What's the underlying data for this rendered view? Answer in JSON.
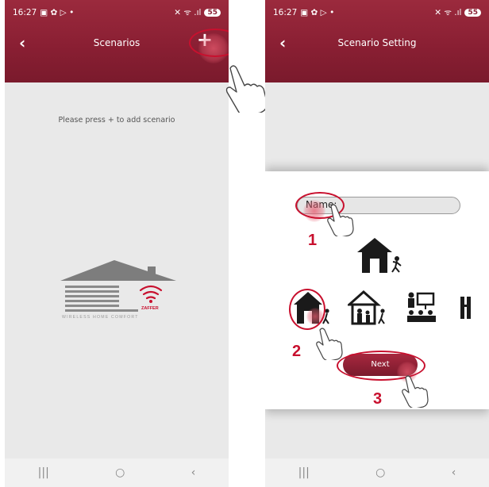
{
  "status_bar": {
    "time": "16:27",
    "icons": "▣ ✿ ▷ •",
    "signal": "✕ ᯤ .ıl",
    "battery": "55"
  },
  "screen1": {
    "back_icon": "‹",
    "title": "Scenarios",
    "add_icon": "+",
    "empty_message": "Please press + to add scenario",
    "logo": {
      "brand": "ZAFFER",
      "tagline": "WIRELESS HOME COMFORT"
    },
    "nav": [
      "|||",
      "○",
      "‹"
    ]
  },
  "screen2": {
    "back_icon": "‹",
    "title": "Scenario Setting",
    "name_label": "Name:",
    "next_label": "Next",
    "steps": [
      "1",
      "2",
      "3"
    ],
    "scenario_icons": [
      "home-icon",
      "family-home-icon",
      "meeting-icon",
      "partial-icon"
    ],
    "nav": [
      "|||",
      "○",
      "‹"
    ]
  },
  "colors": {
    "accent": "#8a1f33",
    "annotation": "#c8102e",
    "background": "#e9e9e9"
  }
}
